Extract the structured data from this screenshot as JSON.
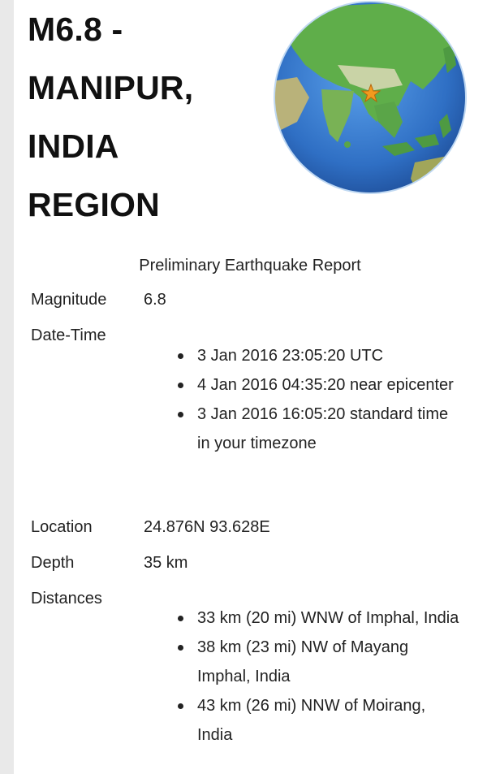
{
  "title": {
    "lines": [
      "M6.8 -",
      "MANIPUR,",
      "INDIA",
      "REGION"
    ]
  },
  "report": {
    "heading": "Preliminary Earthquake Report",
    "magnitude": {
      "label": "Magnitude",
      "value": "6.8"
    },
    "datetime": {
      "label": "Date-Time",
      "items": [
        "3 Jan 2016 23:05:20 UTC",
        "4 Jan 2016 04:35:20 near epicenter",
        "3 Jan 2016 16:05:20 standard time in your timezone"
      ]
    },
    "location": {
      "label": "Location",
      "value": "24.876N 93.628E"
    },
    "depth": {
      "label": "Depth",
      "value": "35 km"
    },
    "distances": {
      "label": "Distances",
      "items": [
        "33 km (20 mi) WNW of Imphal, India",
        "38 km (23 mi) NW of Mayang Imphal, India",
        "43 km (26 mi) NNW of Moirang, India"
      ]
    }
  },
  "colors": {
    "ocean": "#3a7fd0",
    "land": "#5fae4a",
    "epicenter_star": "#f39a1e"
  }
}
